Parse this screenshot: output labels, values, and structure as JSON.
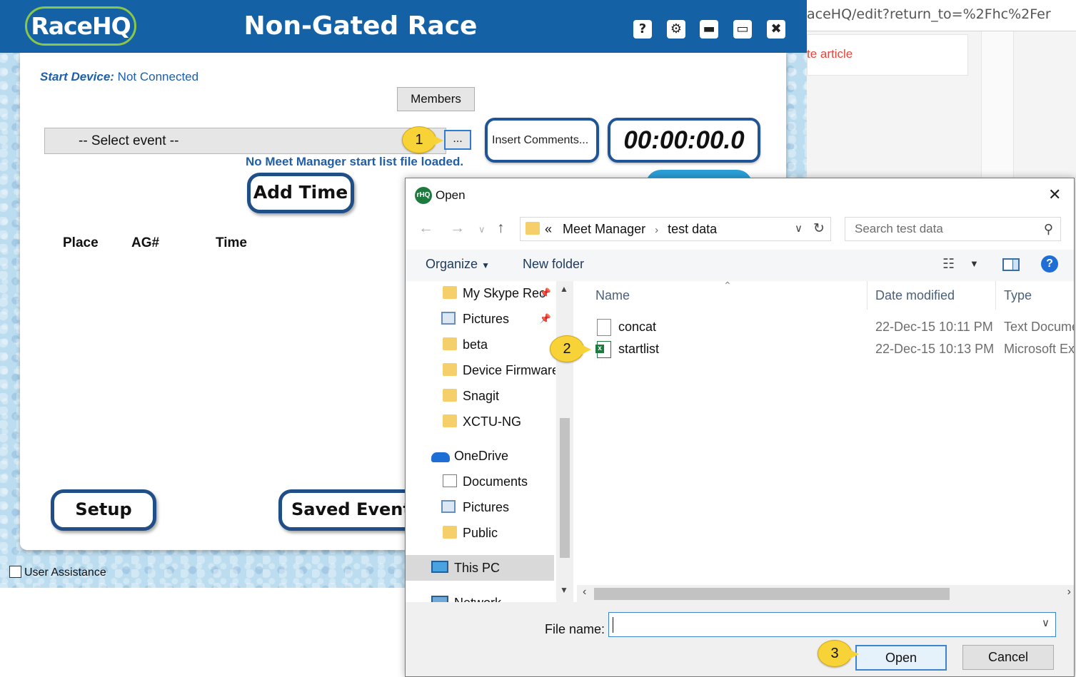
{
  "browser": {
    "url_fragment": "aceHQ/edit?return_to=%2Fhc%2Fer",
    "link_fragment": "te article"
  },
  "app": {
    "logo_text": "RaceHQ",
    "title": "Non-Gated Race",
    "titlebar_buttons": [
      "?",
      "⚙",
      "▬",
      "▭",
      "✖"
    ],
    "start_device_label": "Start Device:",
    "start_device_value": "Not Connected",
    "members_label": "Members",
    "event_select_value": "-- Select event --",
    "ellipsis_label": "...",
    "comments_label": "Insert Comments...",
    "timer": "00:00:00.0",
    "no_meet_text": "No Meet Manager start list file loaded.",
    "add_time_label": "Add Time",
    "columns": [
      "Place",
      "AG#",
      "Time"
    ],
    "setup_label": "Setup",
    "saved_events_label": "Saved Events",
    "user_assistance_label": "User Assistance",
    "accent_color": "#1462a5"
  },
  "dialog": {
    "icon_text": "rHQ",
    "title": "Open",
    "breadcrumb_prefix": "«",
    "breadcrumb": [
      "Meet Manager",
      "test data"
    ],
    "search_placeholder": "Search test data",
    "organize_label": "Organize",
    "new_folder_label": "New folder",
    "nav_items": [
      {
        "label": "My Skype Rec",
        "icon": "folder-icon",
        "pinned": true
      },
      {
        "label": "Pictures",
        "icon": "pictures-icon",
        "pinned": true
      },
      {
        "label": "beta",
        "icon": "folder-icon"
      },
      {
        "label": "Device Firmware",
        "icon": "folder-icon"
      },
      {
        "label": "Snagit",
        "icon": "folder-icon"
      },
      {
        "label": "XCTU-NG",
        "icon": "folder-icon"
      },
      {
        "label": "OneDrive",
        "icon": "onedrive-icon"
      },
      {
        "label": "Documents",
        "icon": "documents-icon"
      },
      {
        "label": "Pictures",
        "icon": "pictures-icon"
      },
      {
        "label": "Public",
        "icon": "folder-icon"
      },
      {
        "label": "This PC",
        "icon": "this-pc-icon",
        "selected": true
      },
      {
        "label": "Network",
        "icon": "network-icon"
      }
    ],
    "columns": {
      "name": "Name",
      "date": "Date modified",
      "type": "Type"
    },
    "files": [
      {
        "name": "concat",
        "date": "22-Dec-15 10:11 PM",
        "type": "Text Docume",
        "icon": "text-file-icon"
      },
      {
        "name": "startlist",
        "date": "22-Dec-15 10:13 PM",
        "type": "Microsoft Ex",
        "icon": "excel-file-icon"
      }
    ],
    "file_name_label": "File name:",
    "file_name_value": "",
    "open_label": "Open",
    "cancel_label": "Cancel"
  },
  "steps": [
    "1",
    "2",
    "3"
  ]
}
